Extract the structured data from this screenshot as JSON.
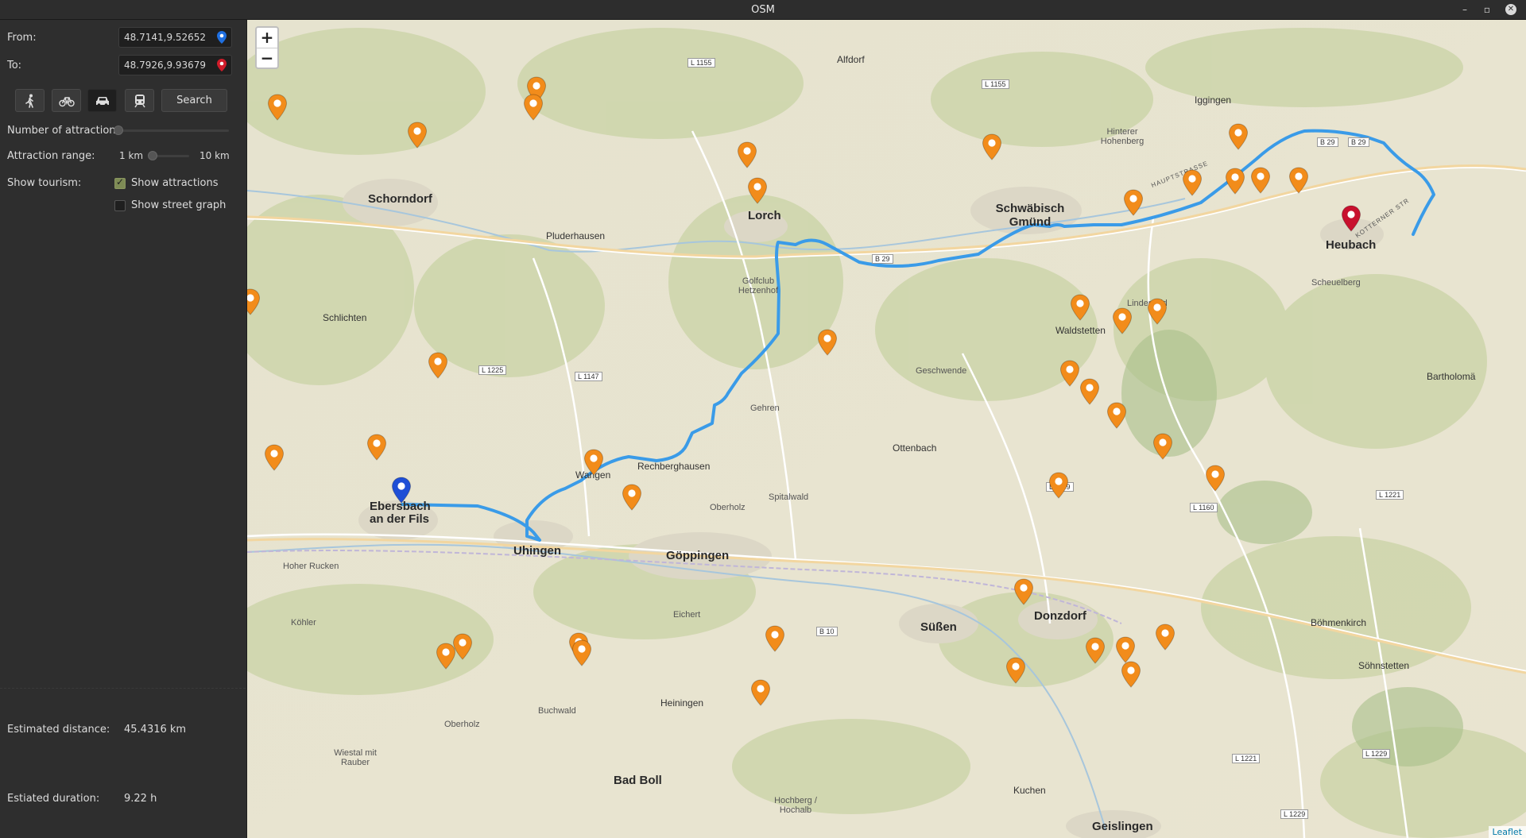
{
  "window": {
    "title": "OSM"
  },
  "sidebar": {
    "from_label": "From:",
    "from_value": "48.7141,9.52652",
    "to_label": "To:",
    "to_value": "48.7926,9.93679",
    "modes": [
      "walk-icon",
      "bike-icon",
      "car-icon",
      "train-icon"
    ],
    "active_mode": "car",
    "search_label": "Search",
    "num_attraction_label": "Number of attraction:",
    "range_label": "Attraction range:",
    "range_min": "1 km",
    "range_max": "10 km",
    "tourism_label": "Show tourism:",
    "show_attractions_label": "Show attractions",
    "show_attractions_checked": true,
    "show_street_graph_label": "Show street graph",
    "show_street_graph_checked": false,
    "distance_label": "Estimated distance:",
    "distance_value": "45.4316 km",
    "duration_label": "Estiated duration:",
    "duration_value": "9.22 h"
  },
  "map": {
    "zoom_in": "+",
    "zoom_out": "−",
    "attribution": "Leaflet",
    "place_labels": [
      "Schorndorf",
      "Pluderhausen",
      "Lorch",
      "Schwäbisch Gmünd",
      "Heubach",
      "Alfdorf",
      "Iggingen",
      "Hinterer Hohenberg",
      "Golfclub Hetzenhof",
      "Lindenfeld",
      "Scheuelberg",
      "Waldstetten",
      "Schlichten",
      "Geschwende",
      "Bartholomä",
      "Gehren",
      "Ottenbach",
      "Rechberghausen",
      "Wangen",
      "Oberholz",
      "Spitalwald",
      "Ebersbach an der Fils",
      "Uhingen",
      "Göppingen",
      "Hoher Rucken",
      "Köhler",
      "Eichert",
      "Süßen",
      "Donzdorf",
      "Böhmenkirch",
      "Söhnstetten",
      "Heiningen",
      "Buchwald",
      "Oberholz",
      "Wiestal mit Rauber",
      "Bad Boll",
      "Hochberg / Hochalb",
      "Kuchen",
      "Geislingen"
    ],
    "road_labels": [
      "L 1155",
      "L 1155",
      "B 29",
      "B 29",
      "B 29",
      "L 1225",
      "L 1147",
      "L 1159",
      "L 1160",
      "L 1221",
      "B 10",
      "L 1221",
      "L 1229",
      "L 1229"
    ],
    "street_labels": [
      "HAUPTSTRASSE",
      "KOTTERNER STR"
    ],
    "marker_colors": {
      "attraction": "#f28c1b",
      "start": "#1f4fd6",
      "end": "#c8102e",
      "route": "#3a9be8"
    }
  }
}
